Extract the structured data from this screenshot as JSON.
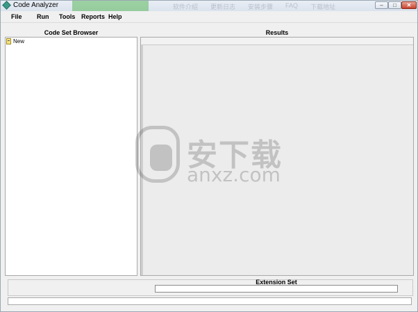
{
  "window": {
    "title": "Code Analyzer",
    "buttons": {
      "minimize": "–",
      "maximize": "□",
      "close": "✕"
    }
  },
  "watermark_banner": {
    "links": [
      "软件介绍",
      "更新日志",
      "安装步骤",
      "FAQ",
      "下载地址"
    ]
  },
  "menu": {
    "items": [
      "File",
      "Run",
      "Tools",
      "Reports",
      "Help"
    ]
  },
  "left_panel": {
    "header": "Code Set Browser",
    "tree": [
      {
        "label": "New",
        "icon": "folder-icon"
      }
    ]
  },
  "right_panel": {
    "header": "Results"
  },
  "extension": {
    "header": "Extension Set",
    "value": ""
  },
  "status": {
    "text": ""
  },
  "watermark": {
    "title": "安下载",
    "domain": "anxz.com"
  },
  "colors": {
    "title_gradient_top": "#e9eef5",
    "banner_green": "#5cb85c",
    "close_button": "#c7422c",
    "panel_border": "#a8a8a8",
    "window_bg": "#f0f0f0"
  }
}
